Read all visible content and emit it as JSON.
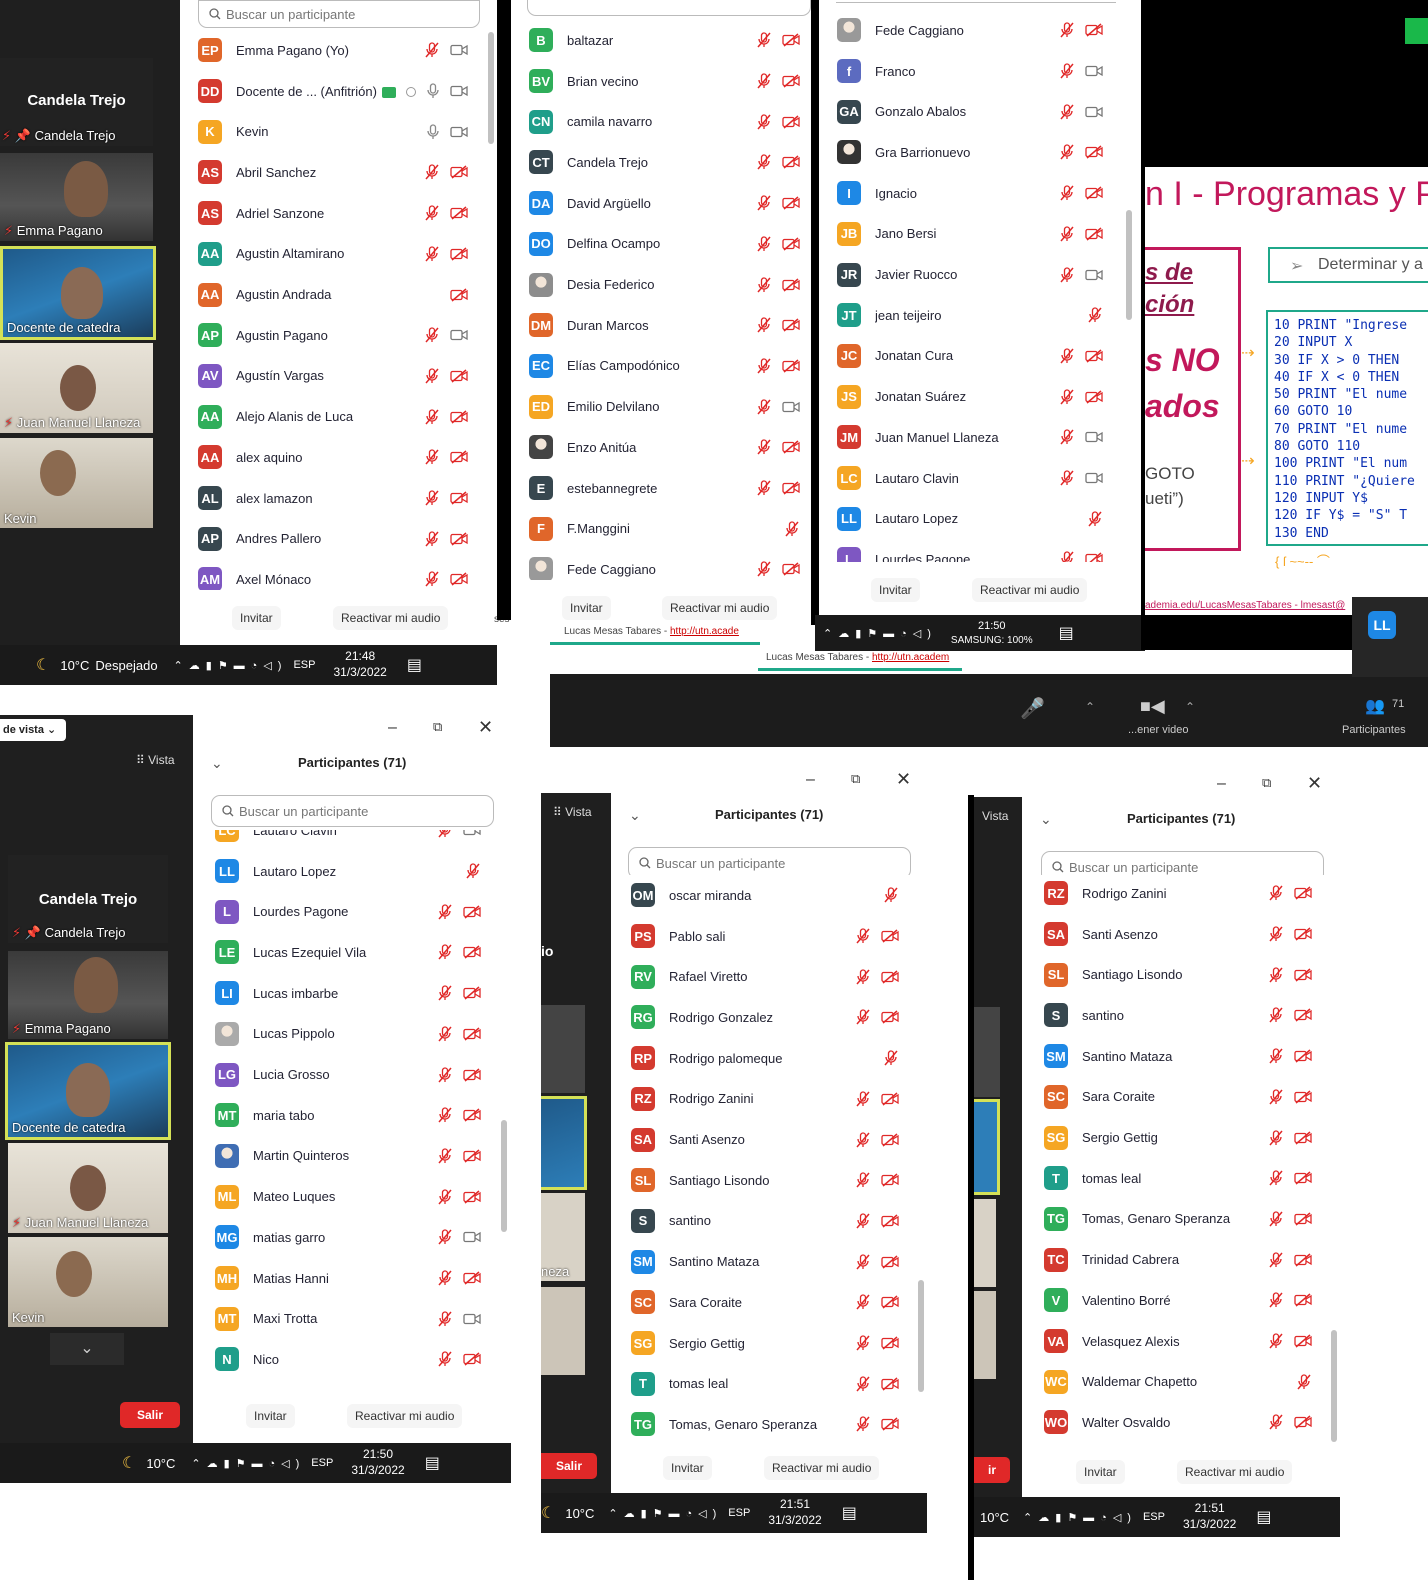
{
  "common": {
    "search_placeholder": "Buscar un participante",
    "invite": "Invitar",
    "reactivate_audio": "Reactivar mi audio",
    "participants_title": "Participantes (71)",
    "view": "Vista",
    "leave": "Salir",
    "lang": "ESP",
    "date": "31/3/2022",
    "temperature": "10°C",
    "weather": "Despejado"
  },
  "panel1": {
    "videos": [
      {
        "label": "Candela Trejo",
        "pinned": "Candela Trejo"
      },
      {
        "label": "Emma Pagano"
      },
      {
        "label": "Docente de catedra"
      },
      {
        "label": "Juan Manuel Llaneza"
      },
      {
        "label": "Kevin"
      }
    ],
    "time": "21:48",
    "partial_text": "ses",
    "participants": [
      {
        "ini": "EP",
        "name": "Emma Pagano (Yo)",
        "color": "#e0662a",
        "mic": "muted",
        "cam": "on"
      },
      {
        "ini": "DD",
        "name": "Docente de ... (Anfitrión)",
        "color": "#d43a2f",
        "mic": "on",
        "cam": "on",
        "host": true
      },
      {
        "ini": "K",
        "name": "Kevin",
        "color": "#f5a623",
        "mic": "on",
        "cam": "on"
      },
      {
        "ini": "AS",
        "name": "Abril Sanchez",
        "color": "#d43a2f",
        "mic": "muted",
        "cam": "off"
      },
      {
        "ini": "AS",
        "name": "Adriel Sanzone",
        "color": "#d43a2f",
        "mic": "muted",
        "cam": "off"
      },
      {
        "ini": "AA",
        "name": "Agustin Altamirano",
        "color": "#1f9e8a",
        "mic": "muted",
        "cam": "off"
      },
      {
        "ini": "AA",
        "name": "Agustin Andrada",
        "color": "#e0662a",
        "mic": "none",
        "cam": "off"
      },
      {
        "ini": "AP",
        "name": "Agustin Pagano",
        "color": "#2fae5a",
        "mic": "muted",
        "cam": "on"
      },
      {
        "ini": "AV",
        "name": "Agustín Vargas",
        "color": "#7e57c2",
        "mic": "muted",
        "cam": "off"
      },
      {
        "ini": "AA",
        "name": "Alejo Alanis de Luca",
        "color": "#2fae5a",
        "mic": "muted",
        "cam": "off"
      },
      {
        "ini": "AA",
        "name": "alex aquino",
        "color": "#d43a2f",
        "mic": "muted",
        "cam": "off"
      },
      {
        "ini": "AL",
        "name": "alex lamazon",
        "color": "#37474f",
        "mic": "muted",
        "cam": "off"
      },
      {
        "ini": "AP",
        "name": "Andres Pallero",
        "color": "#37474f",
        "mic": "muted",
        "cam": "off"
      },
      {
        "ini": "AM",
        "name": "Axel Mónaco",
        "color": "#7e57c2",
        "mic": "muted",
        "cam": "off"
      }
    ]
  },
  "panel2": {
    "participants": [
      {
        "ini": "B",
        "name": "baltazar",
        "color": "#2fae5a",
        "mic": "muted",
        "cam": "off"
      },
      {
        "ini": "BV",
        "name": "Brian vecino",
        "color": "#2fae5a",
        "mic": "muted",
        "cam": "off"
      },
      {
        "ini": "CN",
        "name": "camila navarro",
        "color": "#1f9e8a",
        "mic": "muted",
        "cam": "off"
      },
      {
        "ini": "CT",
        "name": "Candela Trejo",
        "color": "#37474f",
        "mic": "muted",
        "cam": "off"
      },
      {
        "ini": "DA",
        "name": "David Argüello",
        "color": "#1e88e5",
        "mic": "muted",
        "cam": "off"
      },
      {
        "ini": "DO",
        "name": "Delfina Ocampo",
        "color": "#1e88e5",
        "mic": "muted",
        "cam": "off"
      },
      {
        "ini": "",
        "name": "Desia Federico",
        "color": "#8d8d8d",
        "mic": "muted",
        "cam": "off",
        "photo": true
      },
      {
        "ini": "DM",
        "name": "Duran Marcos",
        "color": "#e0662a",
        "mic": "muted",
        "cam": "off"
      },
      {
        "ini": "EC",
        "name": "Elías Campodónico",
        "color": "#1e88e5",
        "mic": "muted",
        "cam": "off"
      },
      {
        "ini": "ED",
        "name": "Emilio Delvilano",
        "color": "#f5a623",
        "mic": "muted",
        "cam": "on"
      },
      {
        "ini": "",
        "name": "Enzo Anitúa",
        "color": "#444",
        "mic": "muted",
        "cam": "off",
        "photo": true
      },
      {
        "ini": "E",
        "name": "estebannegrete",
        "color": "#37474f",
        "mic": "muted",
        "cam": "off"
      },
      {
        "ini": "F",
        "name": "F.Manggini",
        "color": "#e0662a",
        "mic": "none",
        "cam": "muted-only"
      },
      {
        "ini": "",
        "name": "Fede Caggiano",
        "color": "#999",
        "mic": "muted",
        "cam": "off",
        "photo": true
      }
    ],
    "footer_caption": "Lucas Mesas Tabares - ",
    "footer_link": "http://utn.acade"
  },
  "panel3": {
    "participants": [
      {
        "ini": "",
        "name": "Fede Caggiano",
        "color": "#999",
        "mic": "muted",
        "cam": "off",
        "photo": true
      },
      {
        "ini": "f",
        "name": "Franco",
        "color": "#5c6bc0",
        "mic": "muted",
        "cam": "on"
      },
      {
        "ini": "GA",
        "name": "Gonzalo Abalos",
        "color": "#37474f",
        "mic": "muted",
        "cam": "on"
      },
      {
        "ini": "",
        "name": "Gra Barrionuevo",
        "color": "#333",
        "mic": "muted",
        "cam": "off",
        "photo": true
      },
      {
        "ini": "I",
        "name": "Ignacio",
        "color": "#1e88e5",
        "mic": "muted",
        "cam": "off"
      },
      {
        "ini": "JB",
        "name": "Jano Bersi",
        "color": "#f5a623",
        "mic": "muted",
        "cam": "off"
      },
      {
        "ini": "JR",
        "name": "Javier Ruocco",
        "color": "#37474f",
        "mic": "muted",
        "cam": "on"
      },
      {
        "ini": "JT",
        "name": "jean teijeiro",
        "color": "#1f9e8a",
        "mic": "none",
        "cam": "muted-only"
      },
      {
        "ini": "JC",
        "name": "Jonatan Cura",
        "color": "#e0662a",
        "mic": "muted",
        "cam": "off"
      },
      {
        "ini": "JS",
        "name": "Jonatan Suárez",
        "color": "#f5a623",
        "mic": "muted",
        "cam": "off"
      },
      {
        "ini": "JM",
        "name": "Juan Manuel Llaneza",
        "color": "#d43a2f",
        "mic": "muted",
        "cam": "on"
      },
      {
        "ini": "LC",
        "name": "Lautaro Clavin",
        "color": "#f5a623",
        "mic": "muted",
        "cam": "on"
      },
      {
        "ini": "LL",
        "name": "Lautaro Lopez",
        "color": "#1e88e5",
        "mic": "none",
        "cam": "muted-only"
      },
      {
        "ini": "L",
        "name": "Lourdes Pagone",
        "color": "#7e57c2",
        "mic": "muted",
        "cam": "off"
      }
    ],
    "time": "21:50",
    "taskbar_extra": "SAMSUNG: 100%",
    "caption": "Lucas Mesas Tabares - ",
    "caption_link": "http://utn.academ",
    "toolbar_video": "...ener video",
    "toolbar_participants": "Participantes",
    "participants_count": "71"
  },
  "slide": {
    "title": "n I - Programas y Pseu",
    "left_box": [
      "s de",
      "ción"
    ],
    "big_red": [
      "s NO",
      "ados"
    ],
    "goto_text": [
      "GOTO",
      "ueti”)"
    ],
    "determinar": "Determinar y a",
    "code": [
      "10 PRINT \"Ingrese",
      "20 INPUT X",
      "30 IF X > 0 THEN",
      "40 IF X < 0 THEN",
      "50 PRINT \"El nume",
      "60 GOTO 10",
      "70 PRINT \"El nume",
      "80 GOTO 110",
      "100 PRINT \"El num",
      "110 PRINT \"¿Quiere",
      "120 INPUT Y$",
      "120 IF Y$ = \"S\" T",
      "130 END"
    ],
    "footer": "ademia.edu/LucasMesasTabares - lmesast@",
    "avatar": "LL"
  },
  "panel4": {
    "videos": [
      {
        "label": "Candela Trejo",
        "pinned": "Candela Trejo"
      },
      {
        "label": "Emma Pagano"
      },
      {
        "label": "Docente de catedra"
      },
      {
        "label": "Juan Manuel Llaneza"
      },
      {
        "label": "Kevin"
      }
    ],
    "view_menu": "de vista",
    "time": "21:50",
    "participants": [
      {
        "ini": "LC",
        "name": "Lautaro Clavin",
        "color": "#f5a623",
        "mic": "muted",
        "cam": "on"
      },
      {
        "ini": "LL",
        "name": "Lautaro Lopez",
        "color": "#1e88e5",
        "mic": "none",
        "cam": "muted-only"
      },
      {
        "ini": "L",
        "name": "Lourdes Pagone",
        "color": "#7e57c2",
        "mic": "muted",
        "cam": "off"
      },
      {
        "ini": "LE",
        "name": "Lucas Ezequiel Vila",
        "color": "#2fae5a",
        "mic": "muted",
        "cam": "off"
      },
      {
        "ini": "LI",
        "name": "Lucas imbarbe",
        "color": "#1e88e5",
        "mic": "muted",
        "cam": "off"
      },
      {
        "ini": "",
        "name": "Lucas Pippolo",
        "color": "#aaa",
        "mic": "muted",
        "cam": "off",
        "photo": true
      },
      {
        "ini": "LG",
        "name": "Lucia Grosso",
        "color": "#7e57c2",
        "mic": "muted",
        "cam": "off"
      },
      {
        "ini": "MT",
        "name": "maria tabo",
        "color": "#2fae5a",
        "mic": "muted",
        "cam": "off"
      },
      {
        "ini": "",
        "name": "Martin Quinteros",
        "color": "#3f6db3",
        "mic": "muted",
        "cam": "off",
        "photo": true
      },
      {
        "ini": "ML",
        "name": "Mateo Luques",
        "color": "#f5a623",
        "mic": "muted",
        "cam": "off"
      },
      {
        "ini": "MG",
        "name": "matias garro",
        "color": "#1e88e5",
        "mic": "muted",
        "cam": "on"
      },
      {
        "ini": "MH",
        "name": "Matias Hanni",
        "color": "#f5a623",
        "mic": "muted",
        "cam": "off"
      },
      {
        "ini": "MT",
        "name": "Maxi Trotta",
        "color": "#f5a623",
        "mic": "muted",
        "cam": "on"
      },
      {
        "ini": "N",
        "name": "Nico",
        "color": "#1f9e8a",
        "mic": "muted",
        "cam": "off"
      }
    ]
  },
  "panel5": {
    "time": "21:51",
    "participants": [
      {
        "ini": "OM",
        "name": "oscar miranda",
        "color": "#37474f",
        "mic": "none",
        "cam": "muted-only"
      },
      {
        "ini": "PS",
        "name": "Pablo sali",
        "color": "#d43a2f",
        "mic": "muted",
        "cam": "off"
      },
      {
        "ini": "RV",
        "name": "Rafael Viretto",
        "color": "#2fae5a",
        "mic": "muted",
        "cam": "off"
      },
      {
        "ini": "RG",
        "name": "Rodrigo Gonzalez",
        "color": "#2fae5a",
        "mic": "muted",
        "cam": "off"
      },
      {
        "ini": "RP",
        "name": "Rodrigo palomeque",
        "color": "#d43a2f",
        "mic": "none",
        "cam": "muted-only"
      },
      {
        "ini": "RZ",
        "name": "Rodrigo Zanini",
        "color": "#d43a2f",
        "mic": "muted",
        "cam": "off"
      },
      {
        "ini": "SA",
        "name": "Santi Asenzo",
        "color": "#d43a2f",
        "mic": "muted",
        "cam": "off"
      },
      {
        "ini": "SL",
        "name": "Santiago Lisondo",
        "color": "#e0662a",
        "mic": "muted",
        "cam": "off"
      },
      {
        "ini": "S",
        "name": "santino",
        "color": "#37474f",
        "mic": "muted",
        "cam": "off"
      },
      {
        "ini": "SM",
        "name": "Santino Mataza",
        "color": "#1e88e5",
        "mic": "muted",
        "cam": "off"
      },
      {
        "ini": "SC",
        "name": "Sara Coraite",
        "color": "#e0662a",
        "mic": "muted",
        "cam": "off"
      },
      {
        "ini": "SG",
        "name": "Sergio Gettig",
        "color": "#f5a623",
        "mic": "muted",
        "cam": "off"
      },
      {
        "ini": "T",
        "name": "tomas leal",
        "color": "#1f9e8a",
        "mic": "muted",
        "cam": "off"
      },
      {
        "ini": "TG",
        "name": "Tomas, Genaro Speranza",
        "color": "#2fae5a",
        "mic": "muted",
        "cam": "off"
      }
    ],
    "side_fragments": [
      "io",
      "neza"
    ]
  },
  "panel6": {
    "time": "21:51",
    "participants": [
      {
        "ini": "RZ",
        "name": "Rodrigo Zanini",
        "color": "#d43a2f",
        "mic": "muted",
        "cam": "off"
      },
      {
        "ini": "SA",
        "name": "Santi Asenzo",
        "color": "#d43a2f",
        "mic": "muted",
        "cam": "off"
      },
      {
        "ini": "SL",
        "name": "Santiago Lisondo",
        "color": "#e0662a",
        "mic": "muted",
        "cam": "off"
      },
      {
        "ini": "S",
        "name": "santino",
        "color": "#37474f",
        "mic": "muted",
        "cam": "off"
      },
      {
        "ini": "SM",
        "name": "Santino Mataza",
        "color": "#1e88e5",
        "mic": "muted",
        "cam": "off"
      },
      {
        "ini": "SC",
        "name": "Sara Coraite",
        "color": "#e0662a",
        "mic": "muted",
        "cam": "off"
      },
      {
        "ini": "SG",
        "name": "Sergio Gettig",
        "color": "#f5a623",
        "mic": "muted",
        "cam": "off"
      },
      {
        "ini": "T",
        "name": "tomas leal",
        "color": "#1f9e8a",
        "mic": "muted",
        "cam": "off"
      },
      {
        "ini": "TG",
        "name": "Tomas, Genaro Speranza",
        "color": "#2fae5a",
        "mic": "muted",
        "cam": "off"
      },
      {
        "ini": "TC",
        "name": "Trinidad Cabrera",
        "color": "#d43a2f",
        "mic": "muted",
        "cam": "off"
      },
      {
        "ini": "V",
        "name": "Valentino Borré",
        "color": "#2fae5a",
        "mic": "muted",
        "cam": "off"
      },
      {
        "ini": "VA",
        "name": "Velasquez Alexis",
        "color": "#d43a2f",
        "mic": "muted",
        "cam": "off"
      },
      {
        "ini": "WC",
        "name": "Waldemar Chapetto",
        "color": "#f5a623",
        "mic": "none",
        "cam": "muted-only"
      },
      {
        "ini": "WO",
        "name": "Walter Osvaldo",
        "color": "#d43a2f",
        "mic": "muted",
        "cam": "off"
      }
    ]
  }
}
